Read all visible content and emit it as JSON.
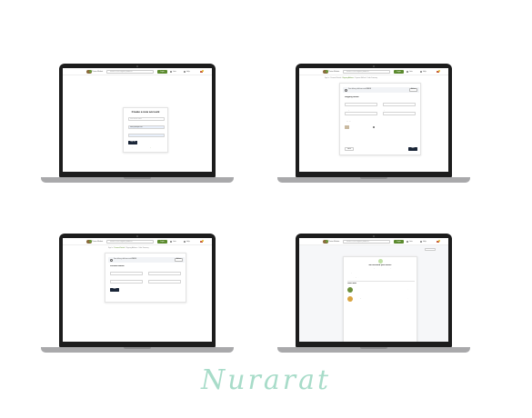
{
  "site": {
    "logo_text": "Thrive Market",
    "search_placeholder": "Search 3,000 organic products",
    "primary_button": "Login",
    "header_links": [
      "Lists",
      "Help"
    ]
  },
  "screen1": {
    "title": "Create a new account",
    "fields": [
      {
        "label": "Your name",
        "value": "First and last name"
      },
      {
        "label": "Email address",
        "value": "hello@example.com"
      },
      {
        "label": "Password",
        "value": ""
      }
    ],
    "submit_label": "Sign up",
    "footer_text": "Already have an account?",
    "footer_link": "Sign in"
  },
  "screen2": {
    "breadcrumb": [
      "Sign In",
      "Personal Details",
      "Shipping Address",
      "Payment Method",
      "Order Summary"
    ],
    "active_step": 2,
    "banner_text": "Free delivery, add items worth",
    "banner_amount": "$49.00",
    "banner_button": "Add now",
    "section_title": "Shipping Details",
    "fields": [
      {
        "label": "Street address",
        "placeholder": ""
      },
      {
        "label": "Unit",
        "placeholder": ""
      },
      {
        "label": "Country",
        "placeholder": ""
      },
      {
        "label": "Zipcode",
        "placeholder": ""
      }
    ],
    "shipping_from_label": "Shipping from",
    "warehouse_text": "Thrive Market Warehouse",
    "back_label": "Back",
    "next_label": "Next"
  },
  "screen3": {
    "breadcrumb": [
      "Sign In",
      "Personal Details",
      "Shipping Address",
      "Order Summary"
    ],
    "active_step": 1,
    "banner_text": "Free delivery, add items worth",
    "banner_amount": "$49.00",
    "banner_button": "Add now",
    "section_title": "Personal Details",
    "fields": [
      {
        "label": "First name",
        "placeholder": ""
      },
      {
        "label": "Last name",
        "placeholder": ""
      },
      {
        "label": "Email address",
        "placeholder": ""
      },
      {
        "label": "Phone number",
        "placeholder": ""
      }
    ],
    "next_label": "Next"
  },
  "screen4": {
    "corner_button": "Dashboard",
    "title": "We received your order!",
    "subtitle": "You will get an email confirmation shortly",
    "info": [
      {
        "label": "Delivery to",
        "value": "John Doe"
      },
      {
        "label": "Order number",
        "value": "#123-456789"
      }
    ],
    "address_line": "1234 Street, Anytown, CA",
    "items_title": "Order items",
    "items": [
      {
        "name": "Cashew Butter",
        "price": "$9.99"
      },
      {
        "name": "Raw Honey",
        "price": "$8.49"
      }
    ]
  },
  "signature": "Nurarat",
  "colors": {
    "accent": "#5b8a2e",
    "dark_button": "#1a2537",
    "signature": "#a8dcc9",
    "laptop_frame": "#1c1c1c",
    "laptop_base": "#a9a9ab"
  }
}
